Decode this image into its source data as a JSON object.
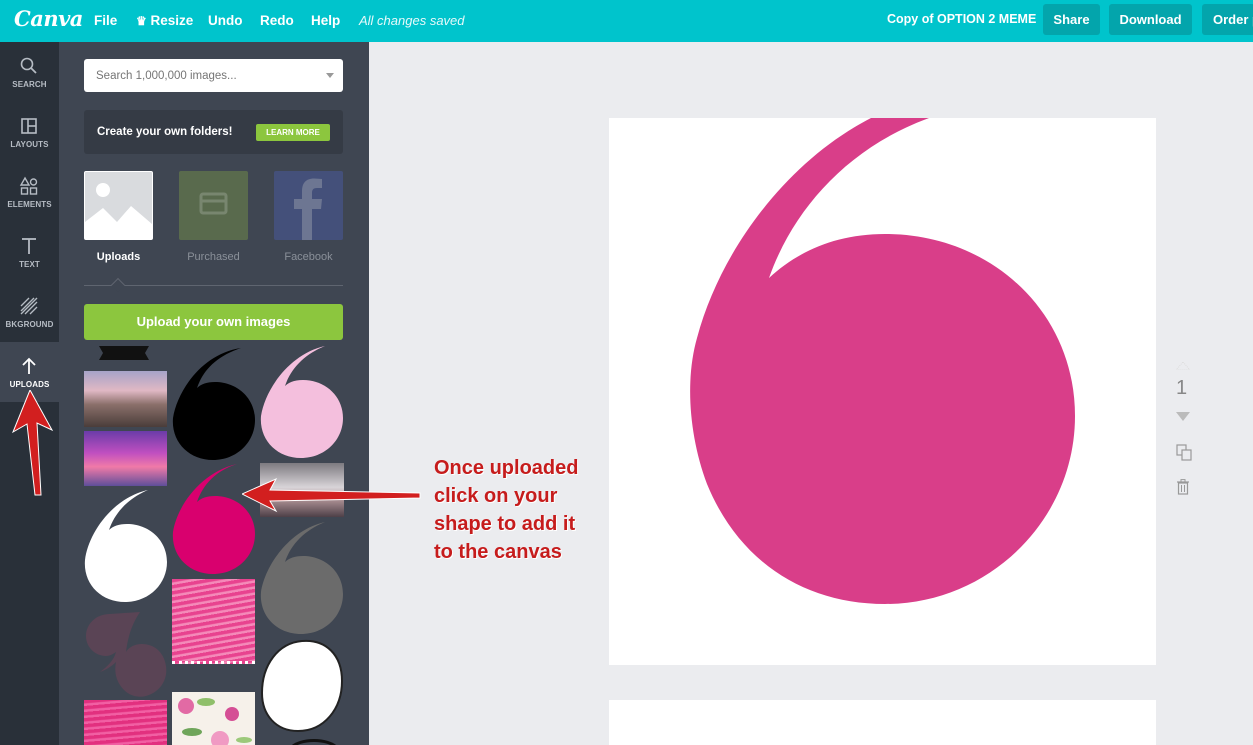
{
  "app": {
    "logo": "Canva"
  },
  "topbar": {
    "menu": [
      "File",
      "Resize",
      "Undo",
      "Redo",
      "Help"
    ],
    "status": "All changes saved",
    "document_title": "Copy of OPTION 2 MEME",
    "share": "Share",
    "download": "Download",
    "order": "Order p",
    "bar_color": "#00c4cc"
  },
  "rail": {
    "items": [
      {
        "label": "SEARCH",
        "icon": "search-icon"
      },
      {
        "label": "LAYOUTS",
        "icon": "layouts-icon"
      },
      {
        "label": "ELEMENTS",
        "icon": "elements-icon"
      },
      {
        "label": "TEXT",
        "icon": "text-icon"
      },
      {
        "label": "BKGROUND",
        "icon": "background-icon"
      },
      {
        "label": "UPLOADS",
        "icon": "upload-arrow-icon",
        "active": true
      }
    ]
  },
  "panel": {
    "search_placeholder": "Search 1,000,000 images...",
    "folders_text": "Create your own folders!",
    "learn_more": "LEARN MORE",
    "sources": [
      {
        "label": "Uploads",
        "active": true
      },
      {
        "label": "Purchased",
        "active": false
      },
      {
        "label": "Facebook",
        "active": false
      }
    ],
    "upload_button": "Upload your own images",
    "accent_color": "#8cc63e"
  },
  "canvas": {
    "page_number": "1",
    "shape_color": "#d93e89"
  },
  "annotation": {
    "lines": [
      "Once uploaded",
      "click on your",
      "shape to add it",
      "to the canvas"
    ],
    "color": "#c61c1c"
  }
}
